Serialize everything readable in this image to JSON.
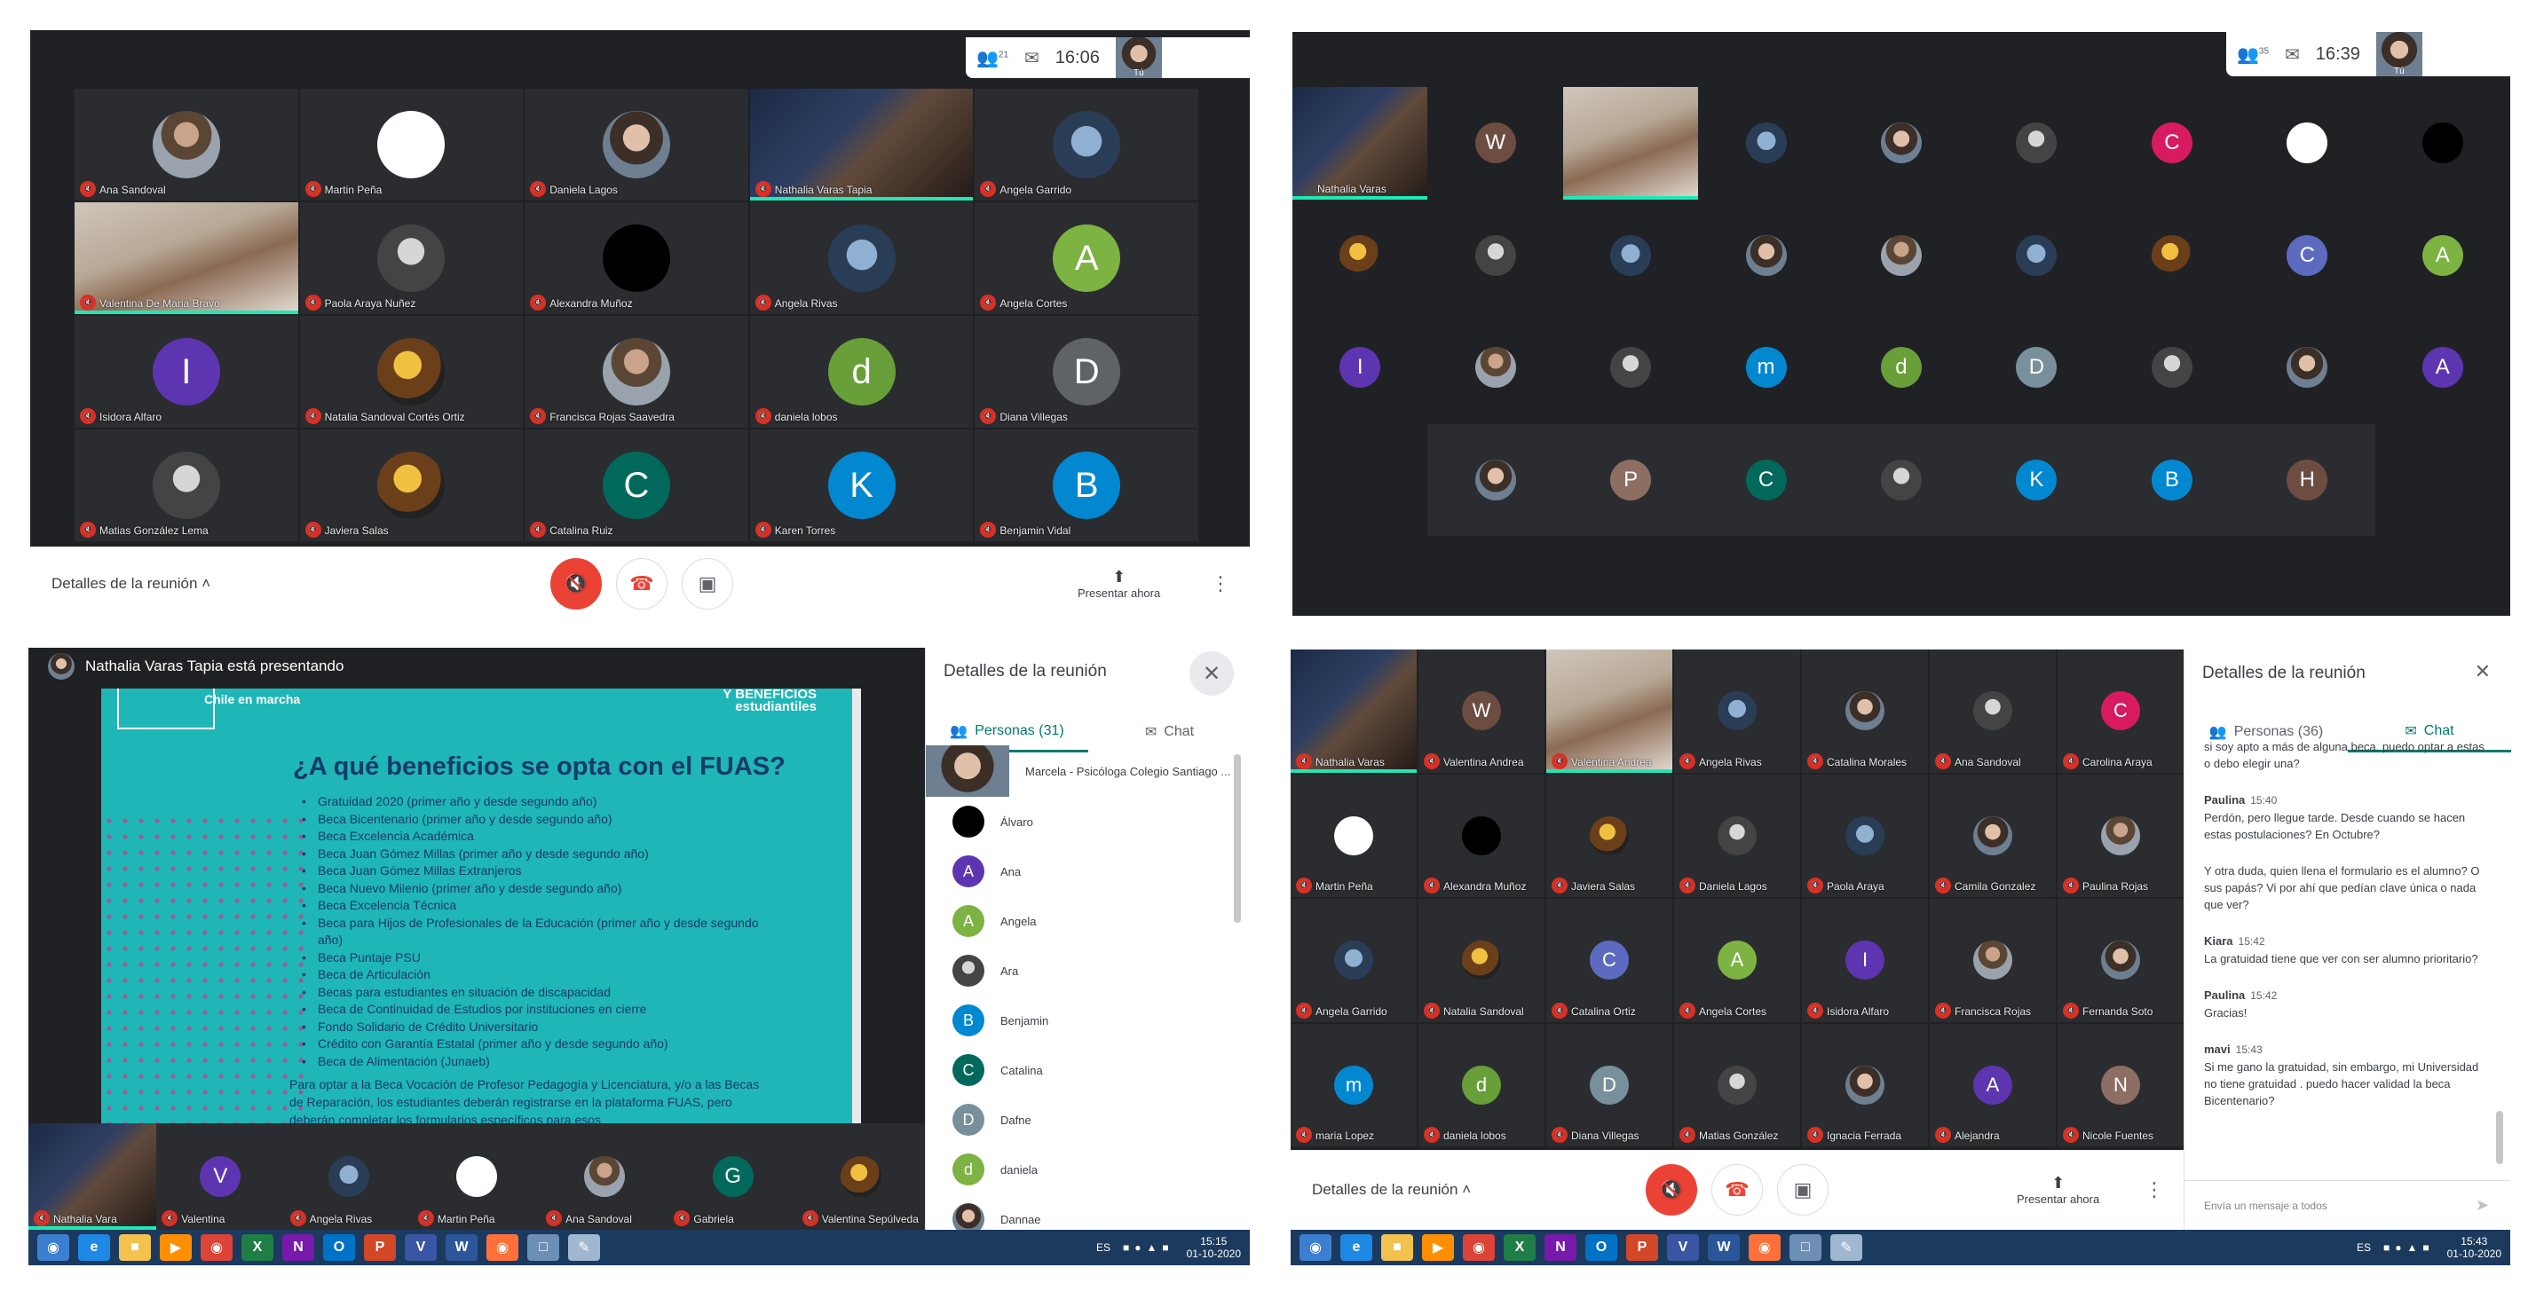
{
  "q1": {
    "participant_count": "21",
    "clock": "16:06",
    "self_label": "Tú",
    "tiles": [
      {
        "name": "Ana Sandoval",
        "avatar": "photo"
      },
      {
        "name": "Martin Peña",
        "avatar": "white"
      },
      {
        "name": "Daniela Lagos",
        "avatar": "photo2"
      },
      {
        "name": "Nathalia Varas Tapia",
        "avatar": "video-dark"
      },
      {
        "name": "Angela Garrido",
        "avatar": "photo3"
      },
      {
        "name": "Valentina De Maria Bravo",
        "avatar": "video-light"
      },
      {
        "name": "Paola Araya Nuñez",
        "avatar": "photo4"
      },
      {
        "name": "Alexandra Muñoz",
        "avatar": "black"
      },
      {
        "name": "Angela Rivas",
        "avatar": "photo3"
      },
      {
        "name": "Angela Cortes",
        "letter": "A",
        "color": "#7cb342"
      },
      {
        "name": "Isidora Alfaro",
        "letter": "I",
        "color": "#5e35b1"
      },
      {
        "name": "Natalia Sandoval Cortés Ortiz",
        "avatar": "photo5"
      },
      {
        "name": "Francisca Rojas Saavedra",
        "avatar": "photo"
      },
      {
        "name": "daniela lobos",
        "letter": "d",
        "color": "#689f38"
      },
      {
        "name": "Diana Villegas",
        "letter": "D",
        "color": "#5f6368"
      },
      {
        "name": "Matias González Lema",
        "avatar": "photo4"
      },
      {
        "name": "Javiera Salas",
        "avatar": "photo5"
      },
      {
        "name": "Catalina Ruiz",
        "letter": "C",
        "color": "#00695c"
      },
      {
        "name": "Karen Torres",
        "letter": "K",
        "color": "#0288d1"
      },
      {
        "name": "Benjamin Vidal",
        "letter": "B",
        "color": "#0288d1"
      }
    ],
    "bottom": {
      "details": "Detalles de la reunión",
      "present": "Presentar ahora"
    }
  },
  "q2": {
    "participant_count": "35",
    "clock": "16:39",
    "self_label": "Tú",
    "speaker_name": "Nathalia Varas",
    "rows": [
      [
        "video-dark",
        "W",
        "video-light",
        "photo3",
        "photo2",
        "photo4",
        "C",
        "white",
        "black"
      ],
      [
        "photo5",
        "photo4",
        "photo3",
        "photo2",
        "photo",
        "photo3",
        "photo5",
        "C2",
        "A"
      ],
      [
        "I",
        "photo",
        "photo4",
        "m",
        "d",
        "D",
        "photo4",
        "photo2",
        "A2"
      ],
      [
        "photo2",
        "P",
        "C3",
        "photo4",
        "K",
        "B",
        "H"
      ]
    ],
    "letters": {
      "W": {
        "letter": "W",
        "color": "#6d4c41"
      },
      "C": {
        "letter": "C",
        "color": "#d81b60"
      },
      "C2": {
        "letter": "C",
        "color": "#5c6bc0"
      },
      "C3": {
        "letter": "C",
        "color": "#00695c"
      },
      "A": {
        "letter": "A",
        "color": "#7cb342"
      },
      "A2": {
        "letter": "A",
        "color": "#5e35b1"
      },
      "I": {
        "letter": "I",
        "color": "#5e35b1"
      },
      "m": {
        "letter": "m",
        "color": "#0288d1"
      },
      "d": {
        "letter": "d",
        "color": "#689f38"
      },
      "D": {
        "letter": "D",
        "color": "#78909c"
      },
      "P": {
        "letter": "P",
        "color": "#8d6e63"
      },
      "K": {
        "letter": "K",
        "color": "#0288d1"
      },
      "B": {
        "letter": "B",
        "color": "#0288d1"
      },
      "H": {
        "letter": "H",
        "color": "#6d4c41"
      }
    }
  },
  "q3": {
    "presenter_banner": "Nathalia Varas Tapia está presentando",
    "slide": {
      "logo_text": "Chile en marcha",
      "corner_text": "Y BENEFICIOS estudiantiles",
      "title": "¿A qué beneficios se opta con el FUAS?",
      "items": [
        "Gratuidad 2020 (primer año y desde segundo año)",
        "Beca Bicentenario (primer año y desde segundo año)",
        "Beca Excelencia Académica",
        "Beca Juan Gómez Millas (primer año y desde segundo año)",
        "Beca Juan Gómez Millas Extranjeros",
        "Beca Nuevo Milenio (primer año y desde segundo año)",
        "Beca Excelencia Técnica",
        "Beca para Hijos de Profesionales de la Educación (primer año y desde segundo año)",
        "Beca Puntaje PSU",
        "Beca de Articulación",
        "Becas para estudiantes en situación de discapacidad",
        "Beca de Continuidad de Estudios por instituciones en cierre",
        "Fondo Solidario de Crédito Universitario",
        "Crédito con Garantía Estatal (primer año y desde segundo año)",
        "Beca de Alimentación (Junaeb)"
      ],
      "footnote": "Para optar a la Beca Vocación de Profesor Pedagogía y Licenciatura, y/o a las Becas de Reparación, los estudiantes deberán registrarse en la plataforma FUAS, pero deberán completar los formularios específicos para esos"
    },
    "strip": [
      {
        "name": "Nathalia Vara",
        "avatar": "video-dark"
      },
      {
        "name": "Valentina",
        "letter": "V",
        "color": "#5e35b1"
      },
      {
        "name": "Angela Rivas",
        "avatar": "photo3"
      },
      {
        "name": "Martin Peña",
        "avatar": "white"
      },
      {
        "name": "Ana Sandoval",
        "avatar": "photo"
      },
      {
        "name": "Gabriela",
        "letter": "G",
        "color": "#00695c"
      },
      {
        "name": "Valentina Sepúlveda",
        "avatar": "photo5"
      }
    ],
    "side": {
      "title": "Detalles de la reunión",
      "tab_people": "Personas (31)",
      "tab_chat": "Chat",
      "people": [
        {
          "name": "Marcela - Psicóloga Colegio Santiago ...",
          "avatar": "photo2"
        },
        {
          "name": "Álvaro",
          "avatar": "black"
        },
        {
          "name": "Ana",
          "letter": "A",
          "color": "#5e35b1"
        },
        {
          "name": "Angela",
          "letter": "A",
          "color": "#7cb342"
        },
        {
          "name": "Ara",
          "avatar": "photo4"
        },
        {
          "name": "Benjamin",
          "letter": "B",
          "color": "#0288d1"
        },
        {
          "name": "Catalina",
          "letter": "C",
          "color": "#00695c"
        },
        {
          "name": "Dafne",
          "letter": "D",
          "color": "#78909c"
        },
        {
          "name": "daniela",
          "letter": "d",
          "color": "#7cb342"
        },
        {
          "name": "Dannae",
          "avatar": "photo2"
        }
      ]
    },
    "taskbar": {
      "lang": "ES",
      "time": "15:15",
      "date": "01-10-2020"
    }
  },
  "q4": {
    "rows": [
      [
        {
          "name": "Nathalia Varas",
          "avatar": "video-dark"
        },
        {
          "name": "Valentina Andrea",
          "letter": "W",
          "color": "#6d4c41"
        },
        {
          "name": "Valentina Andrea",
          "avatar": "video-light"
        },
        {
          "name": "Angela Rivas",
          "avatar": "photo3"
        },
        {
          "name": "Catalina Morales",
          "avatar": "photo2"
        },
        {
          "name": "Ana Sandoval",
          "avatar": "photo4"
        },
        {
          "name": "Carolina Araya",
          "letter": "C",
          "color": "#d81b60"
        }
      ],
      [
        {
          "name": "Martin Peña",
          "avatar": "white"
        },
        {
          "name": "Alexandra Muñoz",
          "avatar": "black"
        },
        {
          "name": "Javiera Salas",
          "avatar": "photo5"
        },
        {
          "name": "Daniela Lagos",
          "avatar": "photo4"
        },
        {
          "name": "Paola Araya",
          "avatar": "photo3"
        },
        {
          "name": "Camila Gonzalez",
          "avatar": "photo2"
        },
        {
          "name": "Paulina Rojas",
          "avatar": "photo"
        }
      ],
      [
        {
          "name": "Angela Garrido",
          "avatar": "photo3"
        },
        {
          "name": "Natalia Sandoval",
          "avatar": "photo5"
        },
        {
          "name": "Catalina Ortiz",
          "letter": "C",
          "color": "#5c6bc0"
        },
        {
          "name": "Angela Cortes",
          "letter": "A",
          "color": "#7cb342"
        },
        {
          "name": "Isidora Alfaro",
          "letter": "I",
          "color": "#5e35b1"
        },
        {
          "name": "Francisca Rojas",
          "avatar": "photo"
        },
        {
          "name": "Fernanda Soto",
          "avatar": "photo2"
        }
      ],
      [
        {
          "name": "maria Lopez",
          "letter": "m",
          "color": "#0288d1"
        },
        {
          "name": "daniela lobos",
          "letter": "d",
          "color": "#689f38"
        },
        {
          "name": "Diana Villegas",
          "letter": "D",
          "color": "#78909c"
        },
        {
          "name": "Matias González",
          "avatar": "photo4"
        },
        {
          "name": "Ignacia Ferrada",
          "avatar": "photo2"
        },
        {
          "name": "Alejandra",
          "letter": "A",
          "color": "#5e35b1"
        },
        {
          "name": "Nicole Fuentes",
          "letter": "N",
          "color": "#8d6e63"
        }
      ]
    ],
    "bottom": {
      "details": "Detalles de la reunión",
      "present": "Presentar ahora"
    },
    "side": {
      "title": "Detalles de la reunión",
      "tab_people": "Personas (36)",
      "tab_chat": "Chat",
      "messages": [
        {
          "who": "",
          "time": "",
          "text": "si soy apto a más de alguna beca, puedo optar a estas o debo elegir una?"
        },
        {
          "who": "Paulina",
          "time": "15:40",
          "text": "Perdón, pero llegue tarde. Desde cuando se hacen estas postulaciones? En Octubre?"
        },
        {
          "who": "",
          "time": "",
          "text": "Y otra duda, quien llena el formulario es el alumno? O sus papás? Vi por ahí que pedían clave única o nada que ver?"
        },
        {
          "who": "Kiara",
          "time": "15:42",
          "text": "La gratuidad tiene que ver con ser alumno prioritario?"
        },
        {
          "who": "Paulina",
          "time": "15:42",
          "text": "Gracias!"
        },
        {
          "who": "mavi",
          "time": "15:43",
          "text": "Si me gano la gratuidad, sin embargo, mi Universidad no tiene gratuidad . puedo hacer validad la beca Bicentenario?"
        }
      ],
      "input_placeholder": "Envía un mensaje a todos"
    },
    "taskbar": {
      "lang": "ES",
      "time": "15:43",
      "date": "01-10-2020"
    }
  },
  "icons": {
    "people": "people-icon",
    "chat": "chat-icon",
    "mic_off": "mic-off-icon",
    "hangup": "hangup-icon",
    "camera": "camera-icon",
    "present": "present-icon",
    "more": "more-vert-icon",
    "close": "close-icon",
    "send": "send-icon",
    "chevron": "chevron-up-icon"
  },
  "colors": {
    "meet_dark": "#202124",
    "tile": "#2b2c2f",
    "danger": "#ea4335",
    "accent": "#00796b",
    "slide": "#1fb6b7"
  }
}
